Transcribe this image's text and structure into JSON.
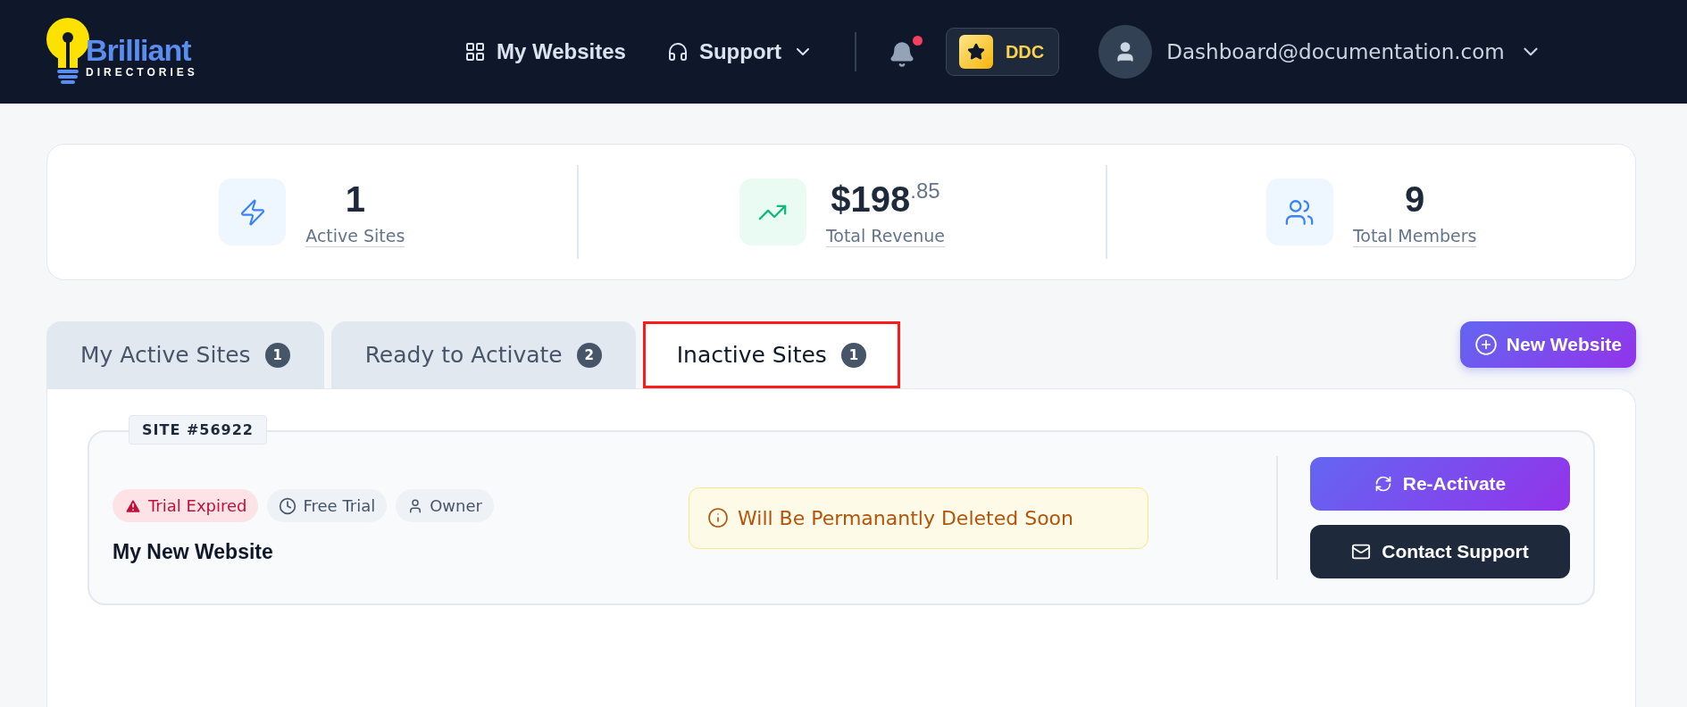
{
  "header": {
    "logo": {
      "word": "Brilliant",
      "subword": "DIRECTORIES"
    },
    "nav": [
      {
        "label": "My Websites",
        "kind": "grid",
        "dropdown": false
      },
      {
        "label": "Support",
        "kind": "headset",
        "dropdown": true
      }
    ],
    "notifications": {
      "unread": true
    },
    "badge": {
      "label": "DDC"
    },
    "account": {
      "email": "Dashboard@documentation.com"
    }
  },
  "stats": [
    {
      "value": "1",
      "label": "Active Sites",
      "kind": "bolt"
    },
    {
      "value": "$198",
      "cents": ".85",
      "label": "Total Revenue",
      "kind": "trend"
    },
    {
      "value": "9",
      "label": "Total Members",
      "kind": "users"
    }
  ],
  "tabs": [
    {
      "label": "My Active Sites",
      "count": "1",
      "selected": false,
      "highlighted": false
    },
    {
      "label": "Ready to Activate",
      "count": "2",
      "selected": false,
      "highlighted": false
    },
    {
      "label": "Inactive Sites",
      "count": "1",
      "selected": true,
      "highlighted": true
    }
  ],
  "new_button": {
    "label": "New Website"
  },
  "site": {
    "number": "SITE #56922",
    "tags": [
      {
        "label": "Trial Expired",
        "kind": "alert"
      },
      {
        "label": "Free Trial",
        "kind": "clock"
      },
      {
        "label": "Owner",
        "kind": "user"
      }
    ],
    "name": "My New Website",
    "notice": "Will Be Permanantly Deleted Soon",
    "actions": [
      {
        "label": "Re-Activate",
        "kind": "primary"
      },
      {
        "label": "Contact Support",
        "kind": "dark"
      }
    ]
  }
}
